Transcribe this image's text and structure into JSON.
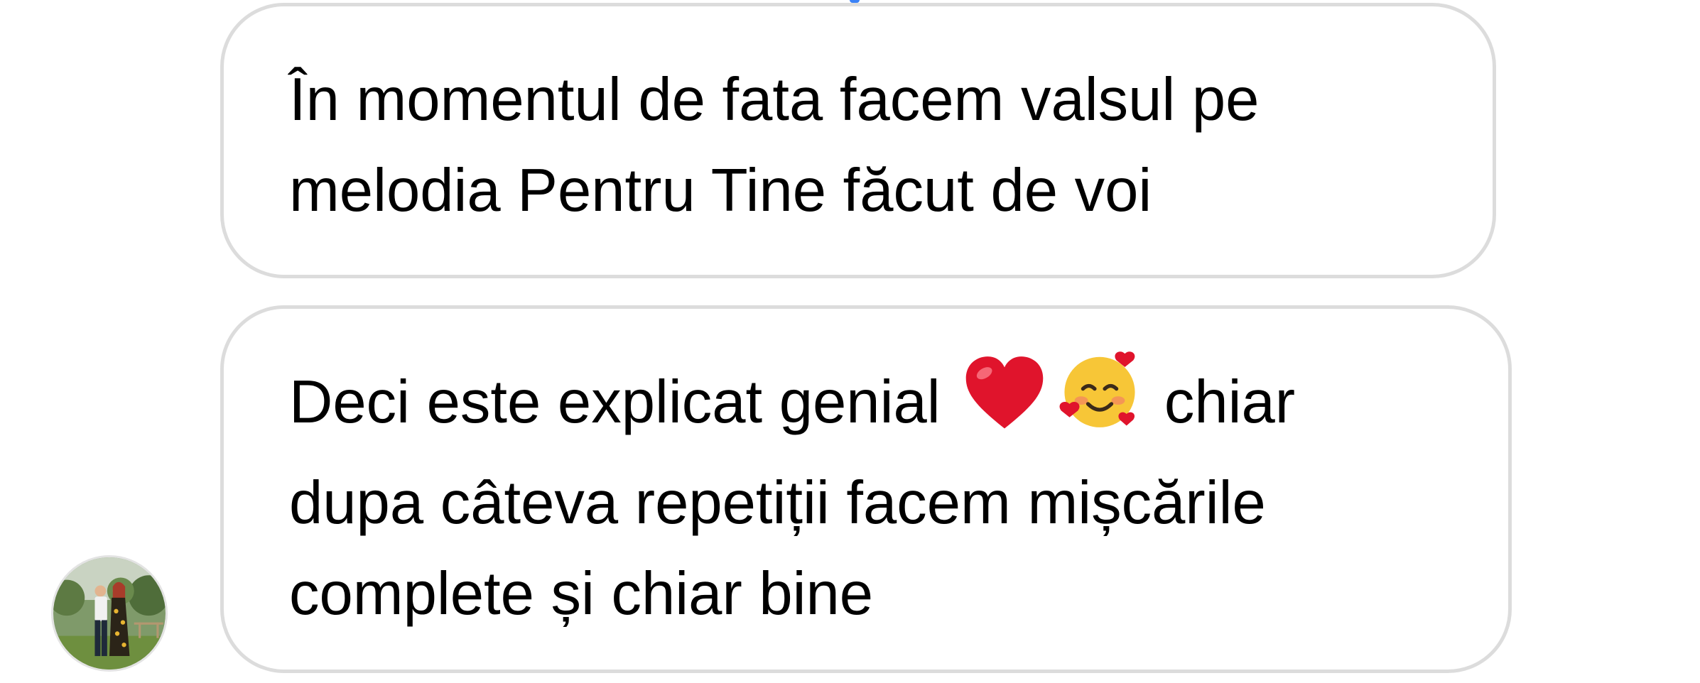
{
  "messages": [
    {
      "lines": [
        "În momentul de fata facem valsul pe",
        "melodia Pentru Tine făcut de voi"
      ]
    },
    {
      "line1_before": "Deci este explicat genial",
      "line1_emoji": [
        "red-heart",
        "smiling-face-with-hearts"
      ],
      "line1_after": "chiar",
      "line2": "dupa câteva repetiții facem mișcările",
      "line3": "complete și chiar bine"
    }
  ],
  "avatar": {
    "icon": "profile-photo-couple"
  },
  "colors": {
    "bubble_border": "#dcdcdc",
    "text": "#000000",
    "background": "#ffffff",
    "heart": "#e0142c",
    "emoji_face": "#f7c637"
  }
}
